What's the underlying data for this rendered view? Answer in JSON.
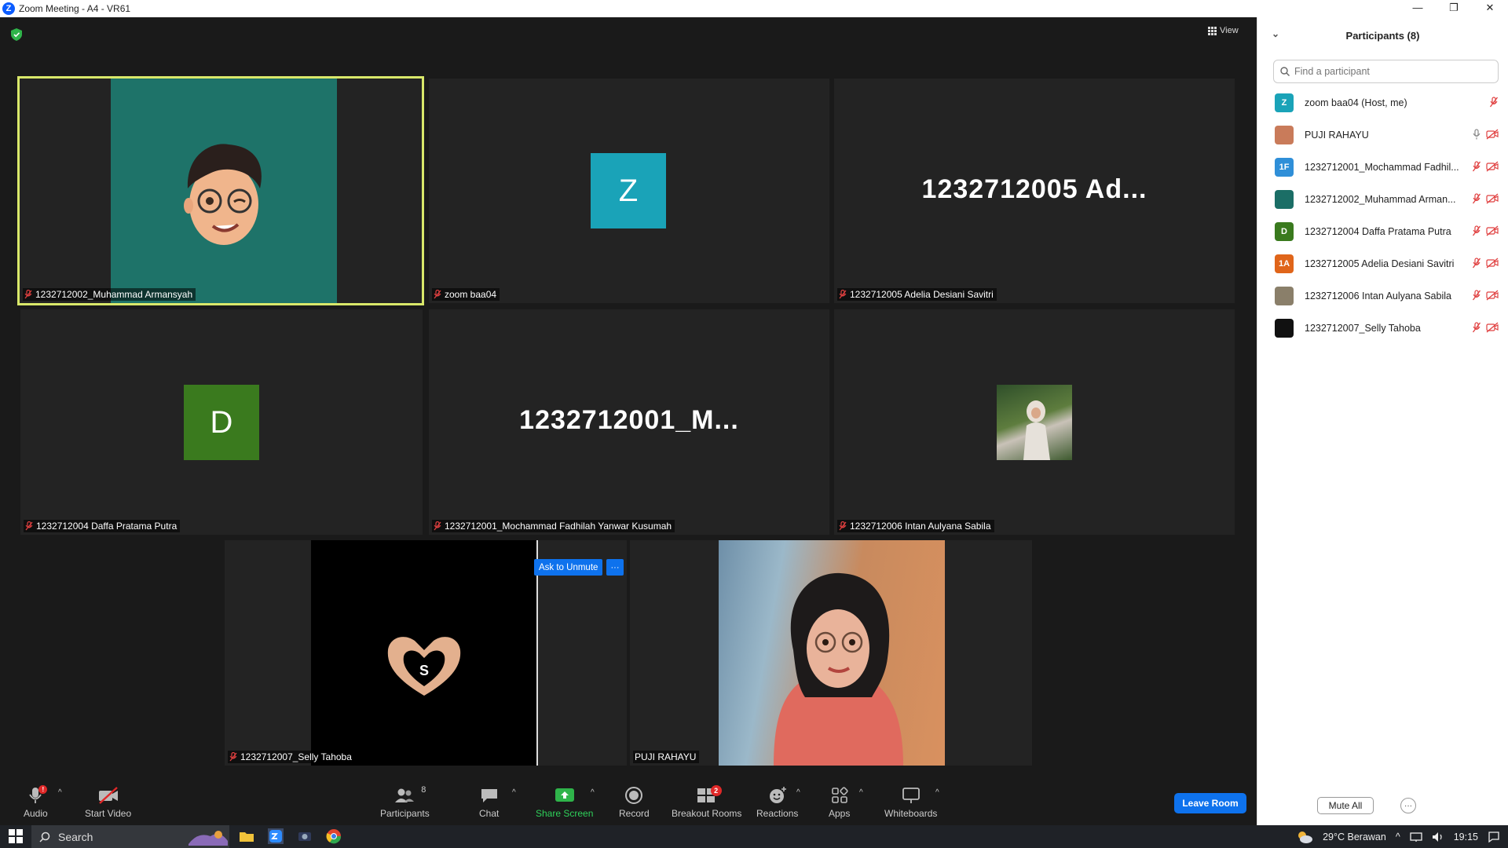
{
  "window": {
    "title": "Zoom Meeting - A4 - VR61",
    "logo_letter": "Z",
    "minimize": "—",
    "restore": "❐",
    "close": "✕"
  },
  "view_label": "View",
  "tiles": {
    "t1": {
      "name": "1232712002_Muhammad Armansyah"
    },
    "t2": {
      "name": "zoom baa04",
      "avatar_letter": "Z"
    },
    "t3": {
      "name": "1232712005 Adelia Desiani Savitri",
      "big_name": "1232712005  Ad..."
    },
    "t4": {
      "name": "1232712004 Daffa Pratama Putra",
      "avatar_letter": "D"
    },
    "t5": {
      "name": "1232712001_Mochammad Fadhilah Yanwar Kusumah",
      "big_name": "1232712001_M..."
    },
    "t6": {
      "name": "1232712006 Intan Aulyana Sabila"
    },
    "t7": {
      "name": "1232712007_Selly Tahoba",
      "avatar_letter": "S"
    },
    "t8": {
      "name": "PUJI RAHAYU"
    }
  },
  "ask_to_unmute": "Ask to Unmute",
  "ask_more": "···",
  "toolbar": {
    "audio": "Audio",
    "audio_badge": "!",
    "start_video": "Start Video",
    "participants": "Participants",
    "participants_count": "8",
    "chat": "Chat",
    "share_screen": "Share Screen",
    "record": "Record",
    "breakout_rooms": "Breakout Rooms",
    "breakout_badge": "2",
    "reactions": "Reactions",
    "apps": "Apps",
    "whiteboards": "Whiteboards",
    "leave_room": "Leave Room"
  },
  "panel": {
    "title": "Participants (8)",
    "search_placeholder": "Find a participant",
    "participants": [
      {
        "name": "zoom baa04 (Host, me)",
        "initials": "Z",
        "color": "#1aa3b8"
      },
      {
        "name": "PUJI RAHAYU",
        "initials": "",
        "color": "#c97b5a"
      },
      {
        "name": "1232712001_Mochammad Fadhil...",
        "initials": "1F",
        "color": "#2f8fd8"
      },
      {
        "name": "1232712002_Muhammad Arman...",
        "initials": "",
        "color": "#1b6e66"
      },
      {
        "name": "1232712004 Daffa Pratama Putra",
        "initials": "D",
        "color": "#3a7a1e"
      },
      {
        "name": "1232712005 Adelia Desiani Savitri",
        "initials": "1A",
        "color": "#e0651a"
      },
      {
        "name": "1232712006 Intan Aulyana Sabila",
        "initials": "",
        "color": "#8a7f6a"
      },
      {
        "name": "1232712007_Selly Tahoba",
        "initials": "",
        "color": "#111111"
      }
    ],
    "mute_all": "Mute All",
    "more": "···"
  },
  "taskbar": {
    "search": "Search",
    "weather": "29°C  Berawan",
    "time": "19:15"
  }
}
